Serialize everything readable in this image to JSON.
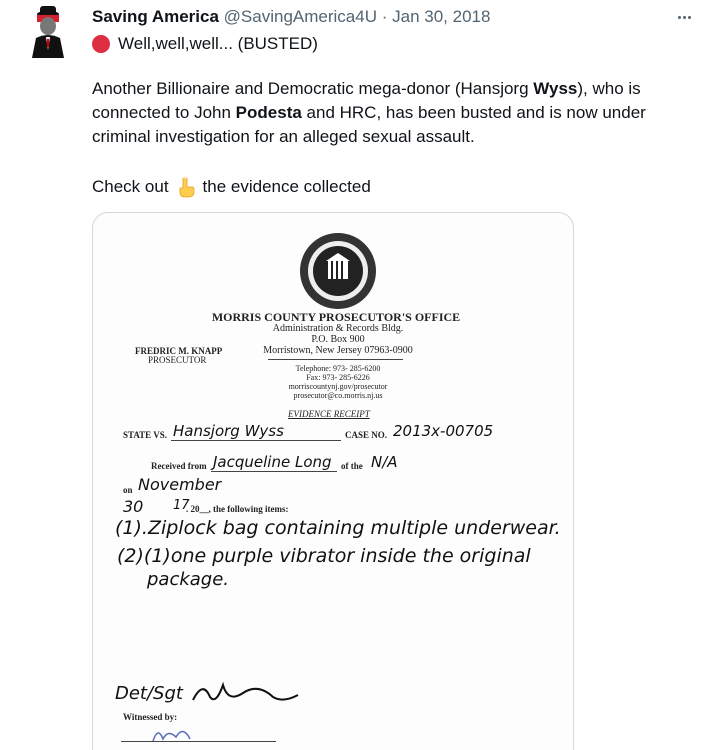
{
  "tweet": {
    "display_name": "Saving America",
    "handle": "@SavingAmerica4U",
    "separator": "·",
    "date": "Jan 30, 2018",
    "line1": "Well,well,well... (BUSTED)",
    "body_parts": {
      "a": "Another Billionaire and Democratic mega-donor (Hansjorg ",
      "b": "Wyss",
      "c": "), who is connected to John ",
      "d": "Podesta",
      "e": " and HRC, has been busted and is now under criminal investigation for an alleged sexual assault."
    },
    "checkout_before": "Check out",
    "checkout_after": "the evidence collected"
  },
  "document": {
    "office": "MORRIS COUNTY PROSECUTOR'S OFFICE",
    "address": [
      "Administration & Records Bldg.",
      "P.O. Box 900",
      "Morristown, New Jersey 07963-0900"
    ],
    "prosecutor_name": "FREDRIC M. KNAPP",
    "prosecutor_title": "PROSECUTOR",
    "contact": [
      "Telephone: 973- 285-6200",
      "Fax: 973- 285-6226",
      "morriscountynj.gov/prosecutor",
      "prosecutor@co.morris.nj.us"
    ],
    "receipt_title": "EVIDENCE RECEIPT",
    "state_vs": "STATE VS.",
    "case_no": "CASE NO.",
    "received_from": "Received from",
    "of_the": "of the",
    "on": "on",
    "following": ". 20__, the following items:",
    "witnessed": "Witnessed by:",
    "hw_defendant": "Hansjorg Wyss",
    "hw_case": "2013x-00705",
    "hw_from": "Jacqueline Long",
    "hw_of": "N/A",
    "hw_month": "November",
    "hw_day": "30",
    "hw_year": "17",
    "hw_item1": "(1).Ziplock bag containing multiple underwear.",
    "hw_item2": "(2)(1)one purple vibrator inside the original",
    "hw_item3": "package.",
    "hw_sig": "Det/Sgt"
  }
}
